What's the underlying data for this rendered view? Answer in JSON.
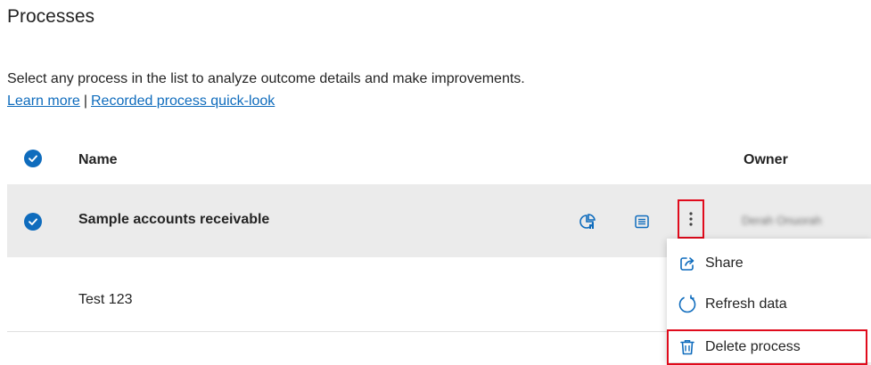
{
  "page": {
    "title": "Processes",
    "description": "Select any process in the list to analyze outcome details and make improvements.",
    "learn_more": "Learn more",
    "separator": "|",
    "quick_look": "Recorded process quick-look"
  },
  "table": {
    "columns": {
      "name": "Name",
      "owner": "Owner"
    },
    "rows": [
      {
        "name": "Sample accounts receivable",
        "owner": "Derah Onuorah",
        "selected": true
      },
      {
        "name": "Test 123",
        "owner": "",
        "selected": false
      }
    ]
  },
  "context_menu": {
    "items": [
      {
        "label": "Share",
        "icon": "share-icon"
      },
      {
        "label": "Refresh data",
        "icon": "refresh-icon"
      },
      {
        "label": "Delete process",
        "icon": "delete-icon"
      }
    ]
  },
  "colors": {
    "accent": "#0f6cbd",
    "highlight": "#e00b1c",
    "selected_row": "#ebebeb"
  }
}
